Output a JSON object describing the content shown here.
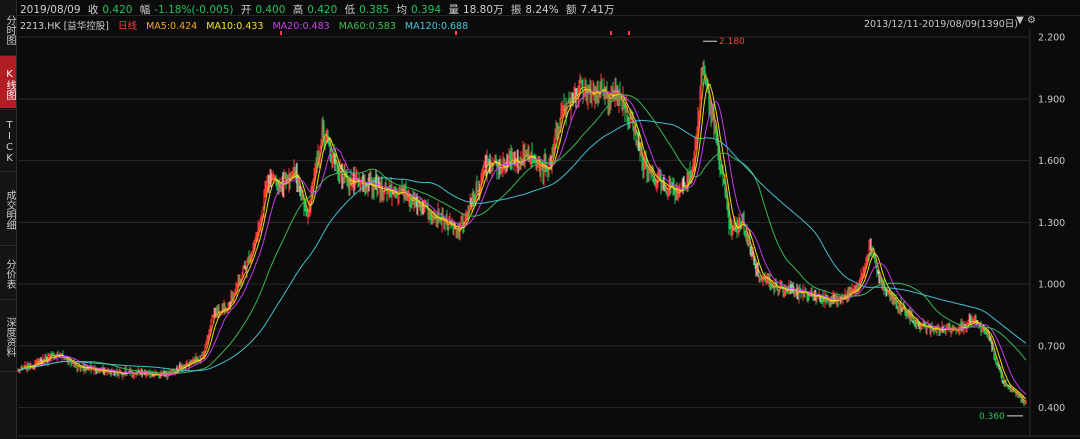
{
  "tabs": [
    {
      "label": "分时图",
      "active": false
    },
    {
      "label": "K线图",
      "active": true
    },
    {
      "label": "TICK",
      "active": false
    },
    {
      "label": "成交明细",
      "active": false
    },
    {
      "label": "分价表",
      "active": false
    },
    {
      "label": "深度资料",
      "active": false
    }
  ],
  "header": {
    "date": "2019/08/09",
    "close_label": "收",
    "close_value": "0.420",
    "change_label": "幅",
    "change_value": "-1.18%(-0.005)",
    "open_label": "开",
    "open_value": "0.400",
    "high_label": "高",
    "high_value": "0.420",
    "low_label": "低",
    "low_value": "0.385",
    "avg_label": "均",
    "avg_value": "0.394",
    "volume_label": "量",
    "volume_value": "18.80万",
    "amp_label": "振",
    "amp_value": "8.24%",
    "amount_label": "额",
    "amount_value": "7.41万"
  },
  "indicators": {
    "symbol": "2213.HK [益华控股]",
    "mode": "日线",
    "ma5": "MA5:0.424",
    "ma10": "MA10:0.433",
    "ma20": "MA20:0.483",
    "ma60": "MA60:0.583",
    "ma120": "MA120:0.688"
  },
  "range_label": "2013/12/11-2019/08/09(1390日)",
  "colors": {
    "up": "#ff3b3b",
    "down": "#23c35a",
    "neutral": "#dddddd",
    "ma5": "#f5a623",
    "ma10": "#f5e623",
    "ma20": "#d13cf2",
    "ma60": "#3dbf52",
    "ma120": "#47c8d8",
    "grid": "#2a2a2e"
  },
  "chart_data": {
    "type": "line",
    "title": "",
    "ylim": [
      0.34,
      2.22
    ],
    "yticks": [
      "2.200",
      "1.900",
      "1.600",
      "1.300",
      "1.000",
      "0.700",
      "0.400"
    ],
    "annotations": {
      "high": "2.180",
      "low": "0.360"
    },
    "price_anchors": [
      [
        0,
        0.58
      ],
      [
        40,
        0.66
      ],
      [
        60,
        0.6
      ],
      [
        100,
        0.57
      ],
      [
        150,
        0.56
      ],
      [
        165,
        0.6
      ],
      [
        185,
        0.65
      ],
      [
        195,
        0.85
      ],
      [
        210,
        0.9
      ],
      [
        225,
        1.05
      ],
      [
        240,
        1.25
      ],
      [
        250,
        1.5
      ],
      [
        262,
        1.48
      ],
      [
        275,
        1.55
      ],
      [
        290,
        1.35
      ],
      [
        305,
        1.75
      ],
      [
        320,
        1.55
      ],
      [
        330,
        1.5
      ],
      [
        345,
        1.48
      ],
      [
        370,
        1.46
      ],
      [
        390,
        1.43
      ],
      [
        410,
        1.36
      ],
      [
        425,
        1.31
      ],
      [
        440,
        1.25
      ],
      [
        455,
        1.4
      ],
      [
        470,
        1.6
      ],
      [
        490,
        1.58
      ],
      [
        510,
        1.62
      ],
      [
        530,
        1.55
      ],
      [
        545,
        1.85
      ],
      [
        560,
        1.95
      ],
      [
        575,
        1.93
      ],
      [
        600,
        1.92
      ],
      [
        615,
        1.8
      ],
      [
        625,
        1.58
      ],
      [
        640,
        1.5
      ],
      [
        660,
        1.45
      ],
      [
        675,
        1.55
      ],
      [
        685,
        2.05
      ],
      [
        695,
        1.8
      ],
      [
        705,
        1.5
      ],
      [
        712,
        1.25
      ],
      [
        725,
        1.3
      ],
      [
        740,
        1.05
      ],
      [
        760,
        0.98
      ],
      [
        780,
        0.96
      ],
      [
        800,
        0.94
      ],
      [
        820,
        0.92
      ],
      [
        840,
        0.98
      ],
      [
        852,
        1.18
      ],
      [
        865,
        0.98
      ],
      [
        880,
        0.9
      ],
      [
        900,
        0.8
      ],
      [
        920,
        0.78
      ],
      [
        940,
        0.79
      ],
      [
        955,
        0.82
      ],
      [
        970,
        0.75
      ],
      [
        985,
        0.52
      ],
      [
        1000,
        0.46
      ],
      [
        1008,
        0.42
      ]
    ]
  }
}
